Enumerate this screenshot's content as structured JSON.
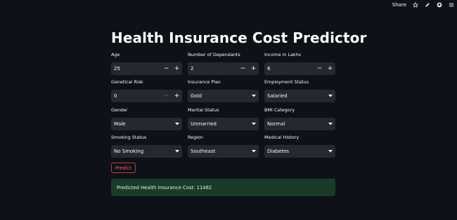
{
  "toolbar": {
    "share_label": "Share",
    "icons": [
      "star-icon",
      "edit-icon",
      "github-icon",
      "menu-icon"
    ]
  },
  "title": "Health Insurance Cost Predictor",
  "fields": {
    "age": {
      "label": "Age",
      "value": "25",
      "type": "number"
    },
    "dependants": {
      "label": "Number of Dependants",
      "value": "2",
      "type": "number"
    },
    "income": {
      "label": "Income in Lakhs",
      "value": "8",
      "type": "number"
    },
    "genetical_risk": {
      "label": "Genetical Risk",
      "value": "0",
      "type": "number"
    },
    "insurance_plan": {
      "label": "Insurance Plan",
      "value": "Gold",
      "type": "select"
    },
    "employment_status": {
      "label": "Employment Status",
      "value": "Salaried",
      "type": "select"
    },
    "gender": {
      "label": "Gender",
      "value": "Male",
      "type": "select"
    },
    "marital_status": {
      "label": "Marital Status",
      "value": "Unmarried",
      "type": "select"
    },
    "bmi_category": {
      "label": "BMI Category",
      "value": "Normal",
      "type": "select"
    },
    "smoking_status": {
      "label": "Smoking Status",
      "value": "No Smoking",
      "type": "select"
    },
    "region": {
      "label": "Region",
      "value": "Southeast",
      "type": "select"
    },
    "medical_history": {
      "label": "Medical History",
      "value": "Diabetes",
      "type": "select"
    }
  },
  "stepper": {
    "minus": "−",
    "plus": "+"
  },
  "predict_label": "Predict",
  "result_text": "Predicted Health Insurance Cost: 11482",
  "colors": {
    "background": "#0e1117",
    "input_bg": "#262730",
    "accent": "#ff4b4b",
    "success_bg": "#1b3b2a"
  }
}
